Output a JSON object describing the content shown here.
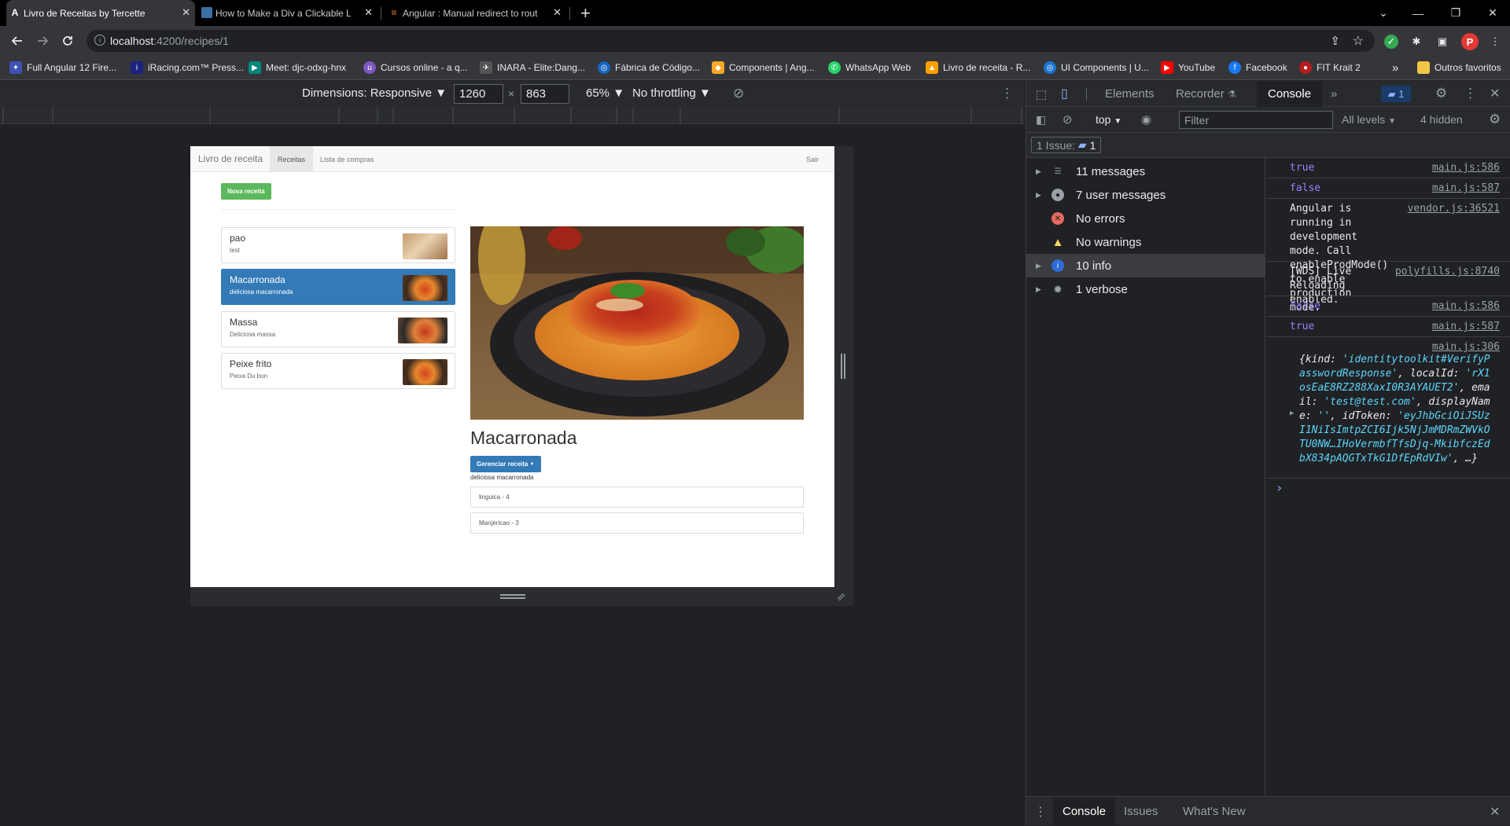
{
  "browser": {
    "tabs": [
      {
        "title": "Livro de Receitas by Tercette",
        "close": "✕"
      },
      {
        "title": "How to Make a Div a Clickable Li",
        "close": "✕"
      },
      {
        "title": "Angular : Manual redirect to rout",
        "close": "✕"
      }
    ],
    "new_tab": "+",
    "window": {
      "dropdown": "⌄",
      "minimize": "—",
      "restore": "❐",
      "close": "✕"
    },
    "address": {
      "host": "localhost",
      "path": ":4200/recipes/1"
    },
    "bookmarks": [
      "Full Angular 12 Fire...",
      "iRacing.com™ Press...",
      "Meet: djc-odxg-hnx",
      "Cursos online - a q...",
      "INARA - Elite:Dang...",
      "Fábrica de Código...",
      "Components | Ang...",
      "WhatsApp Web",
      "Livro de receita - R...",
      "UI Components | U...",
      "YouTube",
      "Facebook",
      "FIT Krait 2"
    ],
    "bookmarks_more": "»",
    "other_bookmarks": "Outros favoritos"
  },
  "device_toolbar": {
    "dimensions_label": "Dimensions: Responsive",
    "width": "1260",
    "height": "863",
    "times": "×",
    "zoom": "65%",
    "throttling": "No throttling"
  },
  "app": {
    "brand": "Livro de receita",
    "nav": [
      "Receitas",
      "Lista de compras"
    ],
    "logout": "Sair",
    "new_recipe": "Nova receita",
    "recipes": [
      {
        "name": "pao",
        "description": "test"
      },
      {
        "name": "Macarronada",
        "description": "deliciosa macarronada"
      },
      {
        "name": "Massa",
        "description": "Deliciosa massa"
      },
      {
        "name": "Peixe frito",
        "description": "Peixa Du bon"
      }
    ],
    "detail": {
      "title": "Macarronada",
      "manage_button": "Gerenciar receita",
      "description": "deliciosa macarronada",
      "ingredients": [
        "linguica - 4",
        "Manjericao - 3"
      ]
    }
  },
  "devtools": {
    "tabs": [
      "Elements",
      "Recorder",
      "Console"
    ],
    "more": "»",
    "issues_badge": "1",
    "context": "top",
    "filter_placeholder": "Filter",
    "levels": "All levels",
    "hidden": "4 hidden",
    "issues_label": "1 Issue:",
    "issues_count": "1",
    "sidebar": [
      {
        "label": "11 messages",
        "icon": "list-icon"
      },
      {
        "label": "7 user messages",
        "icon": "user-icon"
      },
      {
        "label": "No errors",
        "icon": "error-icon"
      },
      {
        "label": "No warnings",
        "icon": "warning-icon"
      },
      {
        "label": "10 info",
        "icon": "info-icon"
      },
      {
        "label": "1 verbose",
        "icon": "bug-icon"
      }
    ],
    "console": [
      {
        "text": "true",
        "src": "main.js:586"
      },
      {
        "text": "false",
        "src": "main.js:587"
      },
      {
        "text": "Angular is running in development mode. Call enableProdMode() to enable production mode.",
        "src": "vendor.js:36521"
      },
      {
        "text": "[WDS] Live Reloading enabled.",
        "src": "polyfills.js:8740"
      },
      {
        "text": "false",
        "src": "main.js:586"
      },
      {
        "text": "true",
        "src": "main.js:587"
      },
      {
        "text": "",
        "src": "main.js:306"
      }
    ],
    "object_log": {
      "open": "{",
      "kind_key": "kind: ",
      "kind_val": "'identitytoolkit#VerifyPasswordResponse'",
      "localId_key": ", localId: ",
      "localId_val": "'rX1osEaE8RZ288XaxI0R3AYAUET2'",
      "email_key": ", email: ",
      "email_val": "'test@test.com'",
      "display_key": ", displayName: ",
      "display_val": "''",
      "token_key": ", idToken: ",
      "token_val": "'eyJhbGciOiJSUzI1NiIsImtpZCI6Ijk5NjJmMDRmZWVkOTU0NW…IHoVermbfTfsDjq-MkibfczEdbX834pAQGTxTkG1DfEpRdVIw'",
      "close": ", …}"
    },
    "prompt": "›",
    "drawer": [
      "Console",
      "Issues",
      "What's New"
    ]
  }
}
